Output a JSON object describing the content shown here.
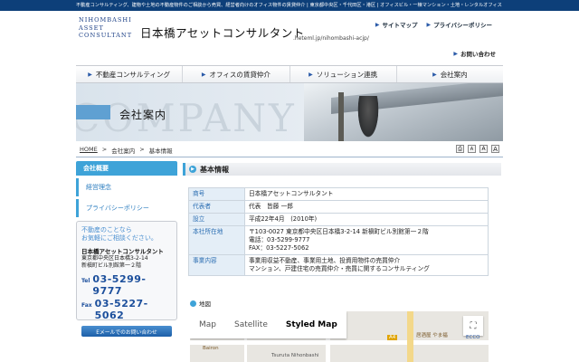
{
  "topbar": {
    "text": "不動産コンサルティング、建物や土地の不動産物件のご相談から売買、経営者向けのオフィス物件の賃貸仲介 | 東京都中央区・千代田区・港区 | オフィスビル・一棟マンション・土地・レンタルオフィス"
  },
  "header": {
    "logo_lines": [
      "NIHOMBASHI",
      "ASSET",
      "CONSULTANT"
    ],
    "title": "日本橋アセットコンサルタント",
    "url": ".heteml.jp/nihombashi-acjp/",
    "links": [
      "サイトマップ",
      "プライバシーポリシー"
    ],
    "contact": "お問い合わせ"
  },
  "nav": [
    "不動産コンサルティング",
    "オフィスの賃貸仲介",
    "ソリューション連携",
    "会社案内"
  ],
  "banner": {
    "bg_word": "COMPANY",
    "title": "会社案内"
  },
  "breadcrumb": [
    "HOME",
    ">",
    "会社案内",
    ">",
    "基本情報"
  ],
  "tools": {
    "print": "⎙",
    "a1": "A",
    "a2": "A",
    "a3": "A"
  },
  "sidebar": {
    "current": "会社概要",
    "items": [
      "経営理念",
      "プライバシーポリシー"
    ]
  },
  "side_box": {
    "q1": "不動産のことなら",
    "q2": "お気軽にご相談ください。",
    "company": "日本橋アセットコンサルタント",
    "addr1": "東京都中央区日本橋3-2-14",
    "addr2": "新槇町ビル別館第一２階",
    "tel_label": "Tel",
    "tel": "03-5299-9777",
    "fax_label": "Fax",
    "fax": "03-5227-5062",
    "mail_button": "Eメールでのお問い合わせ"
  },
  "section": {
    "title": "基本情報"
  },
  "info_table": {
    "rows": [
      {
        "key": "商号",
        "value": "日本橋アセットコンサルタント"
      },
      {
        "key": "代表者",
        "value": "代表　皆藤 一郎"
      },
      {
        "key": "設立",
        "value": "平成22年4月　(2010年)"
      },
      {
        "key": "本社所在地",
        "lines": [
          "〒103-0027 東京都中央区日本橋3-2-14 新槇町ビル別館第一２階",
          "電話：03-5299-9777",
          "FAX：03-5227-5062"
        ]
      },
      {
        "key": "事業内容",
        "lines": [
          "事業用収益不動産、事業用土地、投資用物件の売買仲介",
          "マンション、戸建住宅の売買仲介・売買に関するコンサルティング"
        ]
      }
    ]
  },
  "map": {
    "heading": "地図",
    "types": [
      "Map",
      "Satellite",
      "Styled Map"
    ],
    "selected": "Styled Map",
    "labels": [
      "Bairon",
      "Tsuruta Nihonbashi",
      "居酒屋 やま福",
      "ECCO",
      "A4"
    ]
  }
}
